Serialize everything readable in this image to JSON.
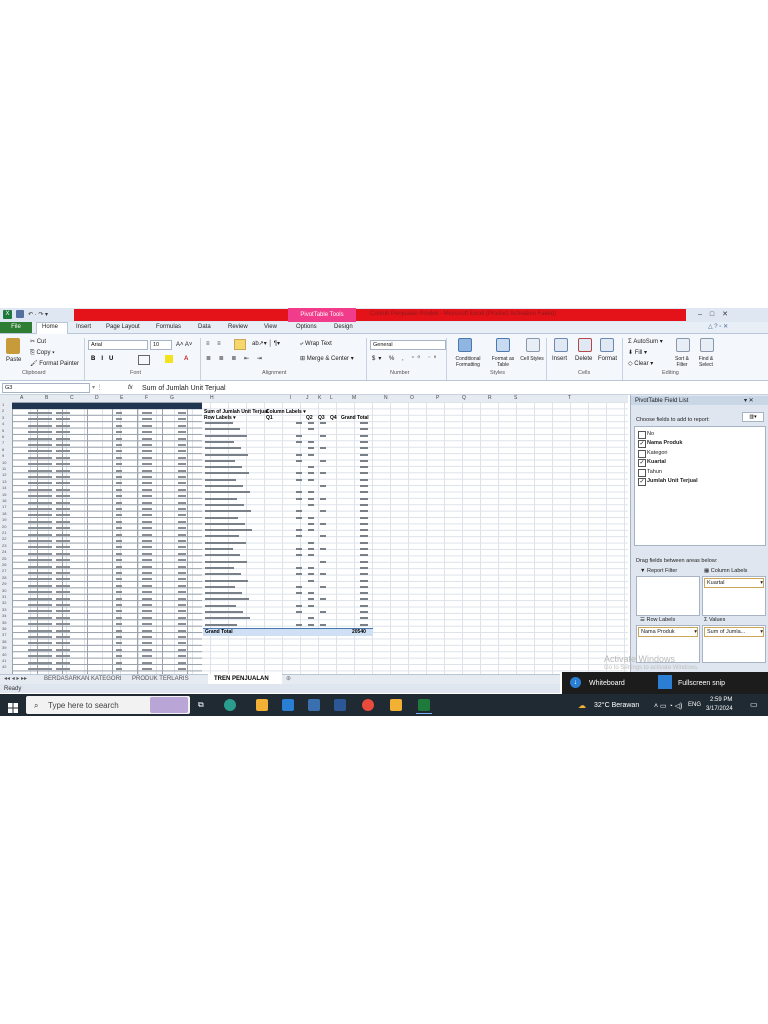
{
  "titlebar": {
    "pivot_tools_label": "PivotTable Tools",
    "window_title": "Contoh Penjualan Produk - Microsoft Excel (Product Activation Failed)"
  },
  "tabs": [
    "File",
    "Home",
    "Insert",
    "Page Layout",
    "Formulas",
    "Data",
    "Review",
    "View",
    "Options",
    "Design"
  ],
  "ribbon": {
    "clipboard": {
      "paste": "Paste",
      "cut": "Cut",
      "copy": "Copy",
      "format_painter": "Format Painter",
      "group_label": "Clipboard"
    },
    "font": {
      "font_name": "Arial",
      "font_size": "10",
      "group_label": "Font"
    },
    "alignment": {
      "wrap_text": "Wrap Text",
      "merge_center": "Merge & Center",
      "group_label": "Alignment"
    },
    "number": {
      "format": "General",
      "group_label": "Number"
    },
    "styles": {
      "conditional": "Conditional Formatting",
      "format_table": "Format as Table",
      "cell_styles": "Cell Styles",
      "group_label": "Styles"
    },
    "cells": {
      "insert": "Insert",
      "delete": "Delete",
      "format": "Format",
      "group_label": "Cells"
    },
    "editing": {
      "autosum": "AutoSum",
      "fill": "Fill",
      "clear": "Clear",
      "sort_filter": "Sort & Filter",
      "find_select": "Find & Select",
      "group_label": "Editing"
    }
  },
  "formula_bar": {
    "name_box": "G3",
    "fx": "fx",
    "content": "Sum of Jumlah Unit Terjual"
  },
  "columns": [
    "A",
    "B",
    "C",
    "D",
    "E",
    "F",
    "G",
    "H",
    "I",
    "J",
    "K",
    "L",
    "M",
    "N",
    "O",
    "P",
    "Q",
    "R",
    "S",
    "T"
  ],
  "pivot": {
    "title": "Sum of Jumlah Unit Terjual",
    "column_labels": "Column Labels",
    "row_labels": "Row Labels",
    "headers": [
      "Q1",
      "Q2",
      "Q3",
      "Q4",
      "Grand Total"
    ],
    "grand_total_label": "Grand Total",
    "grand_total_value": "20540"
  },
  "field_list": {
    "title": "PivotTable Field List",
    "choose_label": "Choose fields to add to report:",
    "fields": [
      {
        "name": "No",
        "checked": false
      },
      {
        "name": "Nama Produk",
        "checked": true
      },
      {
        "name": "Kategori",
        "checked": false
      },
      {
        "name": "Kuartal",
        "checked": true
      },
      {
        "name": "Tahun",
        "checked": false
      },
      {
        "name": "Jumlah Unit Terjual",
        "checked": true
      }
    ],
    "drag_label": "Drag fields between areas below:",
    "report_filter": "Report Filter",
    "column_labels": "Column Labels",
    "column_value": "Kuartal",
    "row_labels": "Row Labels",
    "values": "Values",
    "row_value": "Nama Produk",
    "values_value": "Sum of Jumla..."
  },
  "sheet_tabs": [
    "BERDASARKAN KATEGORI",
    "PRODUK TERLARIS",
    "TREN PENJUALAN"
  ],
  "status": "Ready",
  "notification": {
    "activate_title": "Activate Windows",
    "activate_sub": "Go to Settings to activate Windows.",
    "whiteboard": "Whiteboard",
    "fullscreen": "Fullscreen snip"
  },
  "taskbar": {
    "search_placeholder": "Type here to search",
    "weather": "32°C Berawan",
    "lang": "ENG",
    "time": "2:59 PM",
    "date": "3/17/2024"
  },
  "colors": {
    "accent_red": "#e4131a",
    "pivot_tools": "#f03c8a",
    "file_green": "#2f7d32",
    "taskbar": "#1f2a33"
  }
}
